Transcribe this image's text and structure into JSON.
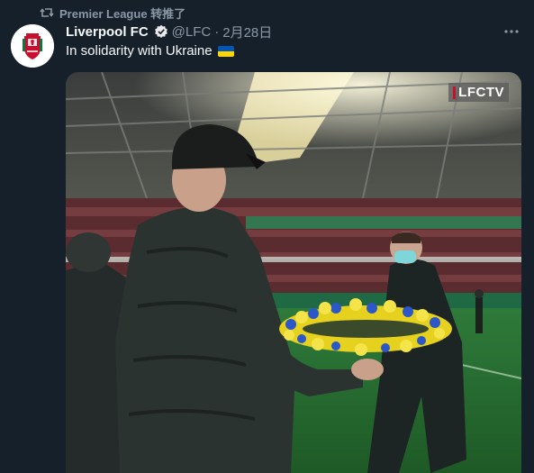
{
  "retweet": {
    "label": "Premier League 转推了"
  },
  "tweet": {
    "display_name": "Liverpool FC",
    "handle": "@LFC",
    "separator": "·",
    "date": "2月28日",
    "text": "In solidarity with Ukraine"
  },
  "media": {
    "watermark": "LFCTV"
  },
  "colors": {
    "background": "#15202b",
    "secondary_text": "#8b98a5",
    "verified": "#1d9bf0",
    "flag_blue": "#0057b7",
    "flag_yellow": "#ffd700",
    "club_red": "#c8102e"
  },
  "icons": {
    "retweet": "retweet-icon",
    "verified": "verified-badge-icon",
    "more": "more-options-icon",
    "flag": "ukraine-flag-emoji"
  }
}
